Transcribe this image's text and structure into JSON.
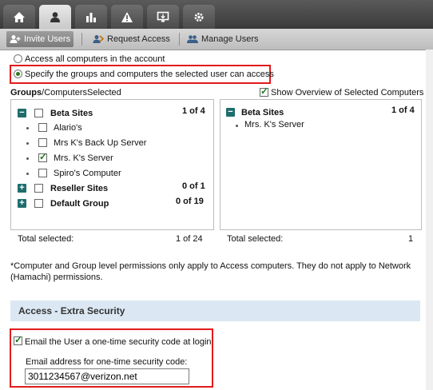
{
  "topnav": {
    "tabs": [
      {
        "icon": "home-icon"
      },
      {
        "icon": "user-icon"
      },
      {
        "icon": "bar-chart-icon"
      },
      {
        "icon": "warning-icon"
      },
      {
        "icon": "monitor-icon"
      },
      {
        "icon": "gear-icon"
      }
    ],
    "active_tab": 1
  },
  "subnav": {
    "invite": "Invite Users",
    "request": "Request Access",
    "manage": "Manage Users"
  },
  "access_options": {
    "all": "Access all computers in the account",
    "specify": "Specify the groups and computers the selected user can access"
  },
  "groups_header": {
    "groups": "Groups",
    "slash": "/",
    "computers": "Computers",
    "selected": "Selected",
    "overview": "Show Overview of Selected Computers"
  },
  "tree": {
    "beta": {
      "name": "Beta Sites",
      "count": "1 of 4"
    },
    "items": [
      "Alario's",
      "Mrs K's Back Up Server",
      "Mrs. K's Server",
      "Spiro's Computer"
    ],
    "reseller": {
      "name": "Reseller Sites",
      "count": "0 of 1"
    },
    "default": {
      "name": "Default Group",
      "count": "0 of 19"
    },
    "total_label": "Total selected:",
    "total_value": "1 of 24"
  },
  "overview": {
    "group": "Beta Sites",
    "count": "1 of 4",
    "item": "Mrs. K's Server",
    "total_label": "Total selected:",
    "total_value": "1"
  },
  "note": "*Computer and Group level permissions only apply to Access computers. They do not apply to Network (Hamachi) permissions.",
  "extra_security": {
    "title": "Access - Extra Security",
    "email_opt": "Email the User a one-time security code at login",
    "email_label": "Email address for one-time security code:",
    "email_value": "3011234567@verizon.net"
  }
}
